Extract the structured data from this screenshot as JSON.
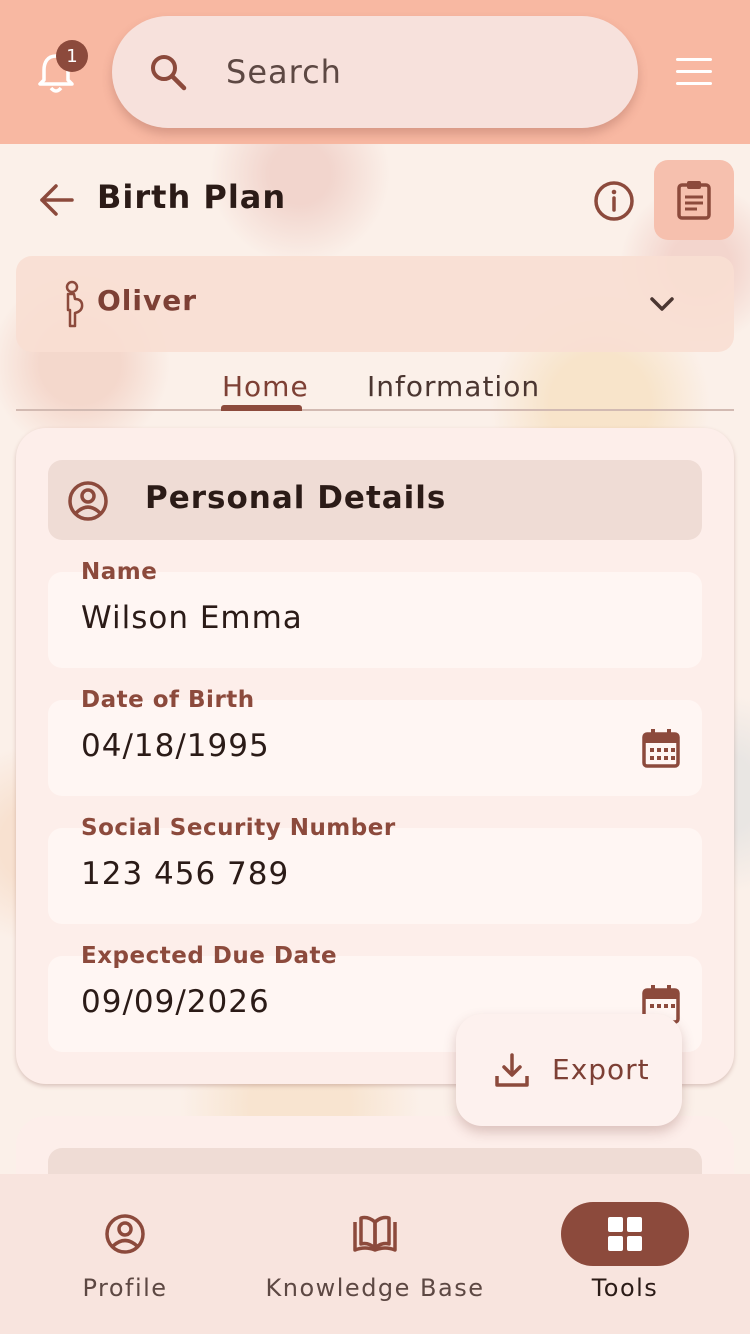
{
  "topbar": {
    "notification_count": "1",
    "search_placeholder": "Search"
  },
  "header": {
    "title": "Birth Plan"
  },
  "patient": {
    "name": "Oliver"
  },
  "tabs": [
    {
      "label": "Home",
      "active": true
    },
    {
      "label": "Information",
      "active": false
    }
  ],
  "section": {
    "title": "Personal Details"
  },
  "fields": {
    "name": {
      "label": "Name",
      "value": "Wilson Emma"
    },
    "dob": {
      "label": "Date of Birth",
      "value": "04/18/1995"
    },
    "ssn": {
      "label": "Social Security Number",
      "value": "123 456 789"
    },
    "due": {
      "label": "Expected Due Date",
      "value": "09/09/2026"
    }
  },
  "export": {
    "label": "Export"
  },
  "bottom_nav": [
    {
      "label": "Profile",
      "icon": "profile-icon",
      "active": false
    },
    {
      "label": "Knowledge Base",
      "icon": "book-icon",
      "active": false
    },
    {
      "label": "Tools",
      "icon": "grid-icon",
      "active": true
    }
  ],
  "colors": {
    "primary": "#8c4a3c",
    "topbar": "#f8b8a2",
    "surface": "#fdeeea"
  }
}
